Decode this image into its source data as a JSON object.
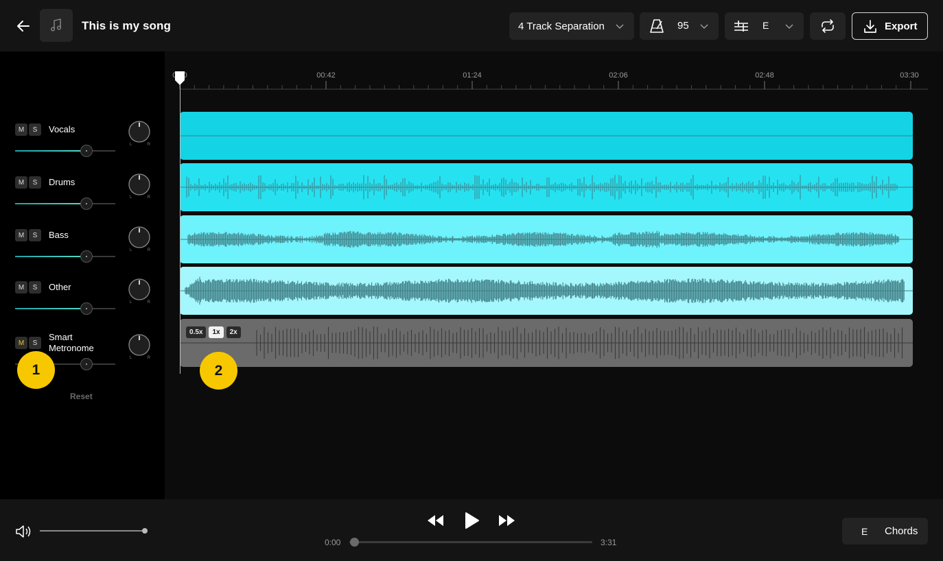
{
  "header": {
    "title": "This is my song",
    "separation_label": "4 Track Separation",
    "tempo_value": "95",
    "key_value": "E",
    "export_label": "Export"
  },
  "tracks": [
    {
      "name": "Vocals",
      "mute": "M",
      "solo": "S",
      "mute_active": false,
      "volume": 0.71,
      "color": "#14d3e4",
      "waveform": "flat"
    },
    {
      "name": "Drums",
      "mute": "M",
      "solo": "S",
      "mute_active": false,
      "volume": 0.71,
      "color": "#26e2f1",
      "waveform": "drums"
    },
    {
      "name": "Bass",
      "mute": "M",
      "solo": "S",
      "mute_active": false,
      "volume": 0.71,
      "color": "#6ef2fb",
      "waveform": "bass"
    },
    {
      "name": "Other",
      "mute": "M",
      "solo": "S",
      "mute_active": false,
      "volume": 0.71,
      "color": "#a4f7fc",
      "waveform": "other"
    },
    {
      "name_line1": "Smart",
      "name_line2": "Metronome",
      "mute": "M",
      "solo": "S",
      "mute_active": true,
      "volume": 0.71,
      "color": "#6b6b6b",
      "waveform": "metronome"
    }
  ],
  "pan_labels": {
    "left": "L",
    "right": "R"
  },
  "reset_label": "Reset",
  "callouts": [
    "1",
    "2"
  ],
  "ruler": {
    "labels": [
      "0:00",
      "00:42",
      "01:24",
      "02:06",
      "02:48",
      "03:30"
    ]
  },
  "metronome_speeds": [
    {
      "label": "0.5x",
      "active": false
    },
    {
      "label": "1x",
      "active": true
    },
    {
      "label": "2x",
      "active": false
    }
  ],
  "footer": {
    "master_volume": 1.0,
    "current_time": "0:00",
    "total_time": "3:31",
    "progress": 0.0,
    "chords_key": "E",
    "chords_label": "Chords"
  },
  "colors": {
    "accent_yellow": "#f7c800",
    "volume_fill": "#4ee0c8",
    "waveform_stroke": "#3f7f86"
  },
  "icons": [
    "back-arrow-icon",
    "music-note-icon",
    "chevron-down-icon",
    "metronome-icon",
    "key-sliders-icon",
    "loop-icon",
    "download-icon",
    "speaker-icon",
    "rewind-icon",
    "play-icon",
    "fast-forward-icon"
  ]
}
